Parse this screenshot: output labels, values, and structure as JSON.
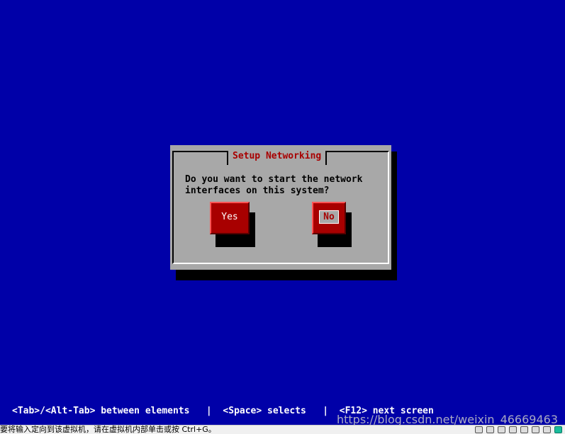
{
  "dialog": {
    "title": "Setup Networking",
    "message": "Do you want to start the network\ninterfaces on this system?",
    "buttons": {
      "yes_label": "Yes",
      "no_label": "No"
    }
  },
  "help_line": "<Tab>/<Alt-Tab> between elements   |  <Space> selects   |  <F12> next screen",
  "host_status": {
    "message": "要将输入定向到该虚拟机，请在虚拟机内部单击或按 Ctrl+G。"
  },
  "watermark": "https://blog.csdn.net/weixin_46669463",
  "colors": {
    "background": "#0000a8",
    "dialog": "#a8a8a8",
    "title": "#a80000",
    "button": "#a80000"
  },
  "icons": [
    "harddisk-icon",
    "cdrom-icon",
    "network-icon",
    "usb-icon",
    "printer-icon",
    "sound-icon",
    "display-icon",
    "vm-status-icon"
  ]
}
